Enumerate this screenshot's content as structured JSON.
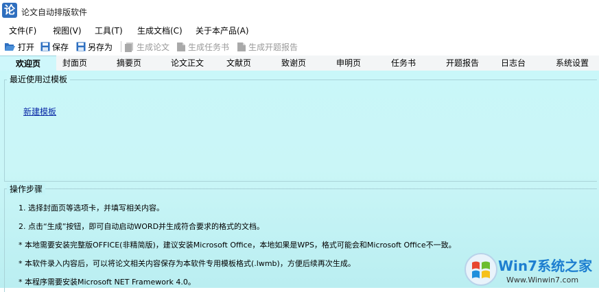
{
  "window": {
    "title": "论文自动排版软件",
    "app_icon_char": "论"
  },
  "menu": [
    {
      "label": "文件(F)"
    },
    {
      "label": "视图(V)"
    },
    {
      "label": "工具(T)"
    },
    {
      "label": "生成文档(C)"
    },
    {
      "label": "关于本产品(A)"
    }
  ],
  "toolbar": {
    "open": "打开",
    "save": "保存",
    "save_as": "另存为",
    "gen_paper": "生成论文",
    "gen_task": "生成任务书",
    "gen_proposal": "生成开题报告"
  },
  "tabs": [
    {
      "label": "欢迎页",
      "active": true
    },
    {
      "label": "封面页"
    },
    {
      "label": "摘要页"
    },
    {
      "label": "论文正文"
    },
    {
      "label": "文献页"
    },
    {
      "label": "致谢页"
    },
    {
      "label": "申明页"
    },
    {
      "label": "任务书"
    },
    {
      "label": "开题报告"
    },
    {
      "label": "日志台"
    },
    {
      "label": "系统设置"
    }
  ],
  "recent": {
    "title": "最近使用过模板",
    "new_template": "新建模板"
  },
  "steps": {
    "title": "操作步骤",
    "items": [
      "1. 选择封面页等选项卡，并填写相关内容。",
      "2. 点击“生成”按钮，即可自动启动WORD并生成符合要求的格式的文档。",
      "* 本地需要安装完整版OFFICE(非精简版)，建议安装Microsoft Office，本地如果是WPS，格式可能会和Microsoft Office不一致。",
      "* 本软件录入内容后，可以将论文相关内容保存为本软件专用模板格式(.lwmb)，方便后续再次生成。",
      "* 本程序需要安装Microsoft NET Framework 4.0。"
    ]
  },
  "watermark": {
    "brand": "Win7系统之家",
    "url": "Www.Winwin7.com"
  },
  "colors": {
    "tab_active": "#cff7fb",
    "panel": "#c9f7f9",
    "link": "#0b2aa6",
    "toolbar_icon": "#2e6fc0"
  }
}
